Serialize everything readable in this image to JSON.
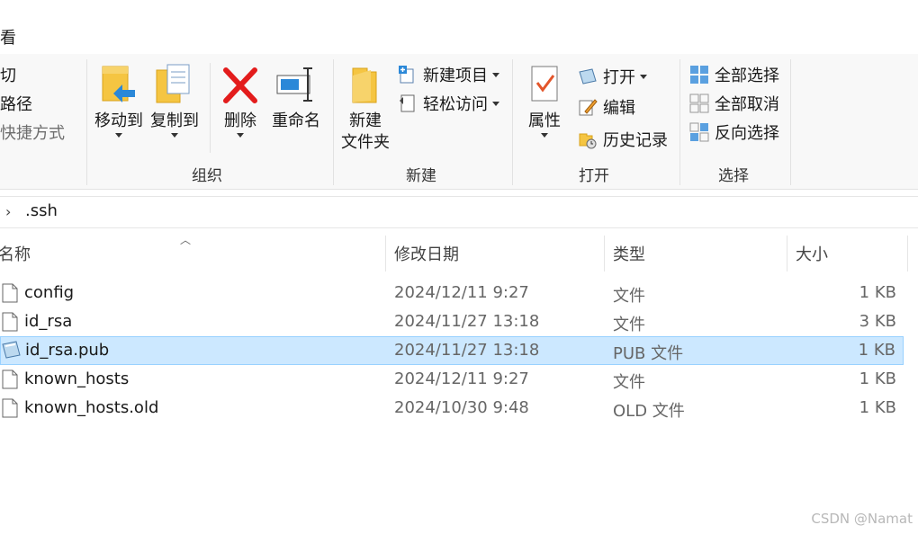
{
  "tab": {
    "label": "查看"
  },
  "ribbon": {
    "clipboard_partial": {
      "cut": "剪切",
      "copy_path": "复制路径",
      "paste_shortcut": "粘贴快捷方式"
    },
    "organize": {
      "move_to": "移动到",
      "copy_to": "复制到",
      "delete": "删除",
      "rename": "重命名",
      "group_label": "组织"
    },
    "new": {
      "new_folder_line1": "新建",
      "new_folder_line2": "文件夹",
      "new_item": "新建项目",
      "easy_access": "轻松访问",
      "group_label": "新建"
    },
    "open": {
      "properties": "属性",
      "open": "打开",
      "edit": "编辑",
      "history": "历史记录",
      "group_label": "打开"
    },
    "select": {
      "select_all": "全部选择",
      "select_none": "全部取消",
      "invert": "反向选择",
      "group_label": "选择"
    }
  },
  "address": {
    "path": ".ssh"
  },
  "columns": {
    "name": "名称",
    "date": "修改日期",
    "type": "类型",
    "size": "大小"
  },
  "files": [
    {
      "name": "config",
      "date": "2024/12/11 9:27",
      "type": "文件",
      "size": "1 KB",
      "selected": false
    },
    {
      "name": "id_rsa",
      "date": "2024/11/27 13:18",
      "type": "文件",
      "size": "3 KB",
      "selected": false
    },
    {
      "name": "id_rsa.pub",
      "date": "2024/11/27 13:18",
      "type": "PUB 文件",
      "size": "1 KB",
      "selected": true
    },
    {
      "name": "known_hosts",
      "date": "2024/12/11 9:27",
      "type": "文件",
      "size": "1 KB",
      "selected": false
    },
    {
      "name": "known_hosts.old",
      "date": "2024/10/30 9:48",
      "type": "OLD 文件",
      "size": "1 KB",
      "selected": false
    }
  ],
  "watermark": "CSDN @Namat",
  "colors": {
    "selection_bg": "#cce8ff",
    "selection_border": "#99d1ff",
    "delete_red": "#e31c1c",
    "folder_yellow": "#f5c542",
    "accent_blue": "#2b88d8"
  }
}
